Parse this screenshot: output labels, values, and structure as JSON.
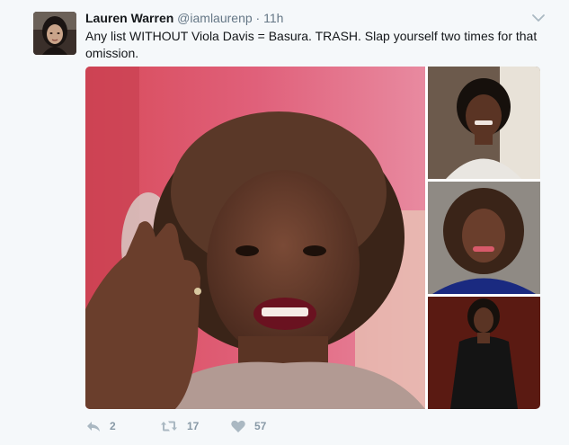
{
  "author": {
    "name": "Lauren Warren",
    "handle": "@iamlaurenp",
    "separator": "·",
    "time": "11h"
  },
  "tweet": {
    "text": "Any list WITHOUT Viola Davis = Basura. TRASH. Slap yourself two times for that omission."
  },
  "actions": {
    "replies": "2",
    "retweets": "17",
    "likes": "57"
  },
  "icons": {
    "caret": "chevron-down-icon",
    "reply": "reply-icon",
    "retweet": "retweet-icon",
    "like": "heart-icon"
  },
  "colors": {
    "background": "#f5f8fa",
    "text": "#14171a",
    "secondary": "#657786",
    "action": "#8899a6"
  }
}
